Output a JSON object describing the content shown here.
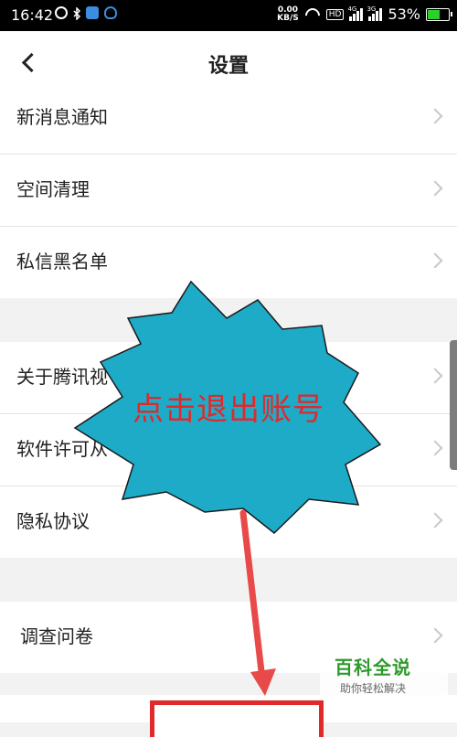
{
  "status_bar": {
    "time": "16:42",
    "net_speed_value": "0.00",
    "net_speed_unit": "KB/S",
    "hd_label": "HD",
    "signal1_tag": "4G",
    "signal2_tag": "3G",
    "battery_percent": "53%",
    "battery_level": 0.53,
    "battery_color": "#2bd12b"
  },
  "nav": {
    "title": "设置"
  },
  "group1": {
    "items": [
      "新消息通知",
      "空间清理",
      "私信黑名单"
    ]
  },
  "group2": {
    "items": [
      "关于腾讯视",
      "软件许可从",
      "隐私协议"
    ]
  },
  "group3": {
    "items": [
      "调查问卷"
    ]
  },
  "callout": {
    "text": "点击退出账号",
    "fill": "#1eabc8",
    "text_color": "#e0292b"
  },
  "arrow_color": "#e84a4a",
  "watermark": {
    "main": "百科全说",
    "sub": "助你轻松解决"
  }
}
